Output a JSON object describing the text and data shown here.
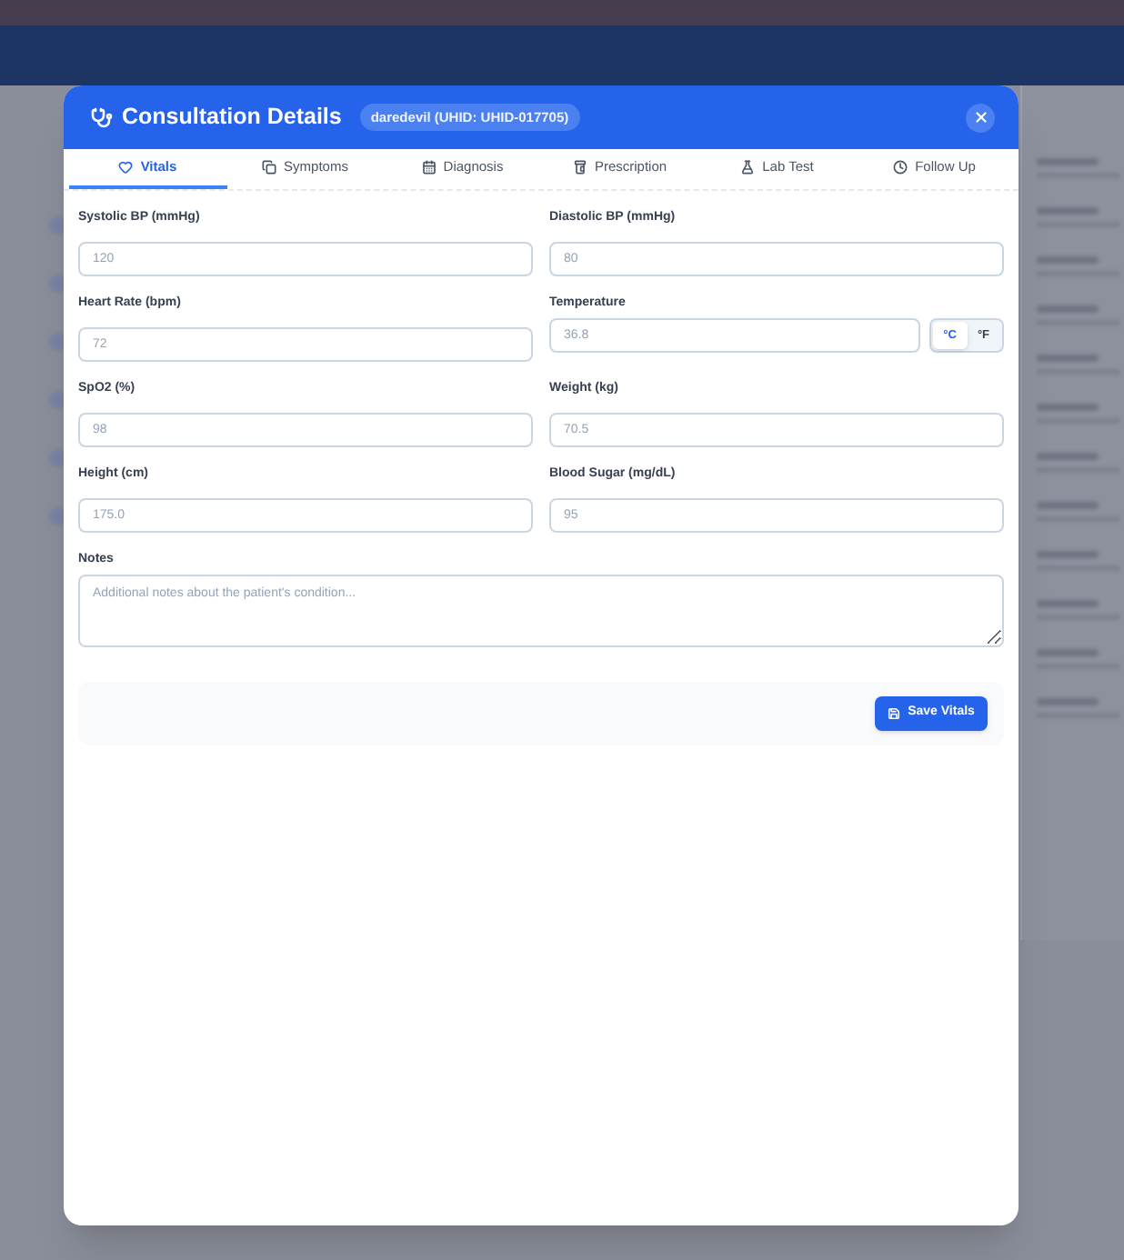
{
  "modal": {
    "title": "Consultation Details",
    "patient_badge": "daredevil (UHID: UHID-017705)"
  },
  "tabs": [
    {
      "label": "Vitals",
      "selected": true
    },
    {
      "label": "Symptoms",
      "selected": false
    },
    {
      "label": "Diagnosis",
      "selected": false
    },
    {
      "label": "Prescription",
      "selected": false
    },
    {
      "label": "Lab Test",
      "selected": false
    },
    {
      "label": "Follow Up",
      "selected": false
    }
  ],
  "fields": [
    {
      "kind": "input",
      "label": "Systolic BP (mmHg)",
      "placeholder": "120"
    },
    {
      "kind": "input",
      "label": "Diastolic BP (mmHg)",
      "placeholder": "80"
    },
    {
      "kind": "input",
      "label": "Heart Rate (bpm)",
      "placeholder": "72"
    },
    {
      "kind": "temperature",
      "label": "Temperature",
      "placeholder": "36.8",
      "units": [
        {
          "label": "°C",
          "selected": true
        },
        {
          "label": "°F",
          "selected": false
        }
      ]
    },
    {
      "kind": "input",
      "label": "SpO2 (%)",
      "placeholder": "98"
    },
    {
      "kind": "input",
      "label": "Weight (kg)",
      "placeholder": "70.5"
    },
    {
      "kind": "input",
      "label": "Height (cm)",
      "placeholder": "175.0"
    },
    {
      "kind": "input",
      "label": "Blood Sugar (mg/dL)",
      "placeholder": "95"
    },
    {
      "kind": "textarea",
      "label": "Notes",
      "placeholder": "Additional notes about the patient's condition..."
    }
  ],
  "save_button": "Save Vitals"
}
